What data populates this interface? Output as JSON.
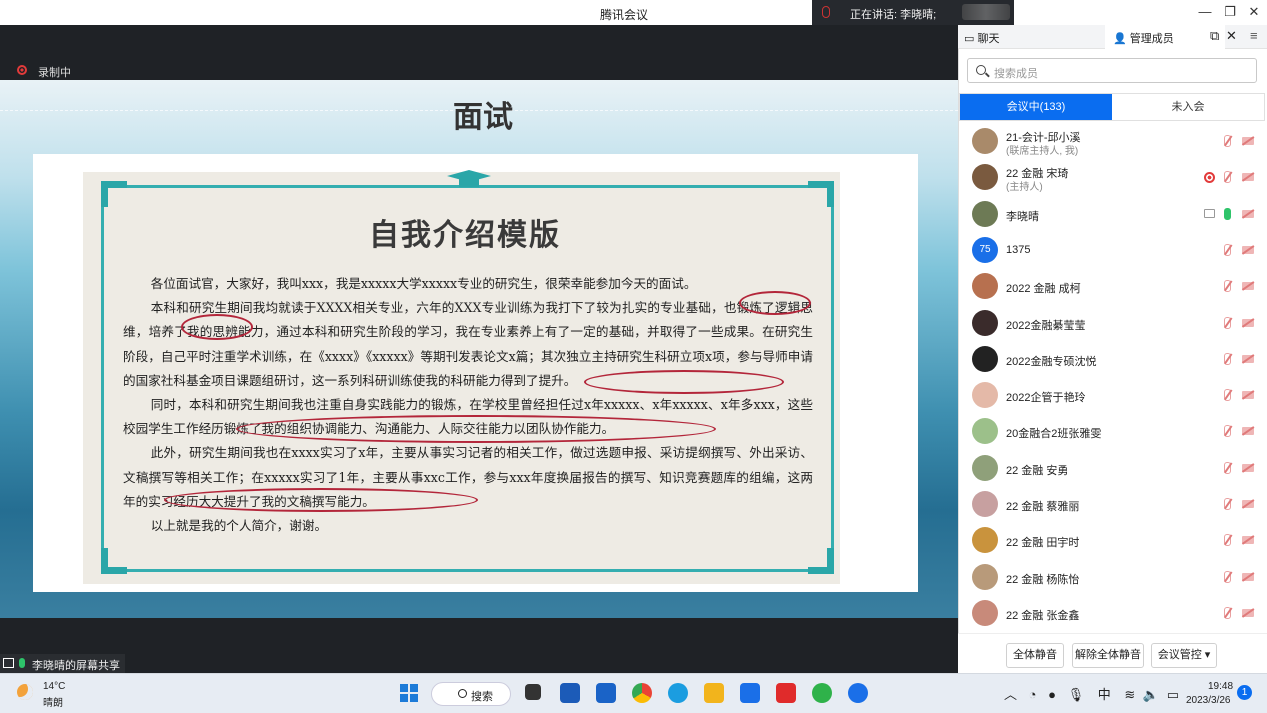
{
  "window": {
    "title": "腾讯会议",
    "speaking_label": "正在讲话: 李晓晴;",
    "min": "—",
    "restore": "❐",
    "close": "✕"
  },
  "meeting": {
    "recording_label": "录制中",
    "share_label": "李晓晴的屏幕共享"
  },
  "slide": {
    "title": "面试",
    "doc_title": "自我介绍模版",
    "paragraphs": [
      "各位面试官，大家好，我叫xxx，我是xxxxx大学xxxxx专业的研究生，很荣幸能参加今天的面试。",
      "本科和研究生期间我均就读于XXXX相关专业，六年的XXX专业训练为我打下了较为扎实的专业基础，也锻炼了逻辑思维，培养了我的思辨能力，通过本科和研究生阶段的学习，我在专业素养上有了一定的基础，并取得了一些成果。在研究生阶段，自己平时注重学术训练，在《xxxx》《xxxxx》等期刊发表论文x篇；其次独立主持研究生科研立项x项，参与导师申请的国家社科基金项目课题组研讨，这一系列科研训练使我的科研能力得到了提升。",
      "同时，本科和研究生期间我也注重自身实践能力的锻炼，在学校里曾经担任过x年xxxxx、x年xxxxx、x年多xxx，这些校园学生工作经历锻炼了我的组织协调能力、沟通能力、人际交往能力以团队协作能力。",
      "此外，研究生期间我也在xxxx实习了x年，主要从事实习记者的相关工作，做过选题申报、采访提纲撰写、外出采访、文稿撰写等相关工作；在xxxxx实习了1年，主要从事xxc工作，参与xxx年度换届报告的撰写、知识竞赛题库的组编，这两年的实习经历大大提升了我的文稿撰写能力。",
      "以上就是我的个人简介，谢谢。"
    ]
  },
  "panel": {
    "tab_chat": "聊天",
    "tab_members": "管理成员",
    "search_placeholder": "搜索成员",
    "seg_in": "会议中(133)",
    "seg_out": "未入会",
    "members": [
      {
        "name": "21-会计-邱小溪",
        "sub": "(联席主持人, 我)",
        "color": "#a98a6a"
      },
      {
        "name": "22 金融 宋琦",
        "sub": "(主持人)",
        "color": "#7a5a3f"
      },
      {
        "name": "李晓晴",
        "sub": "",
        "color": "#6d7a55"
      },
      {
        "name": "1375",
        "sub": "",
        "color": "#1a6fe8",
        "initials": "75"
      },
      {
        "name": "2022 金融 成柯",
        "sub": "",
        "color": "#b7704f"
      },
      {
        "name": "2022金融綦莹莹",
        "sub": "",
        "color": "#3a2b2b"
      },
      {
        "name": "2022金融专硕沈悦",
        "sub": "",
        "color": "#222222"
      },
      {
        "name": "2022企管于艳玲",
        "sub": "",
        "color": "#e4b9a8"
      },
      {
        "name": "20金融合2班张雅雯",
        "sub": "",
        "color": "#9cc08a"
      },
      {
        "name": "22 金融 安勇",
        "sub": "",
        "color": "#8fa07a"
      },
      {
        "name": "22 金融 蔡雅丽",
        "sub": "",
        "color": "#c7a0a0"
      },
      {
        "name": "22 金融 田宇时",
        "sub": "",
        "color": "#c9933d"
      },
      {
        "name": "22 金融 杨陈怡",
        "sub": "",
        "color": "#b89a7a"
      },
      {
        "name": "22 金融 张金鑫",
        "sub": "",
        "color": "#c88a7a"
      }
    ],
    "btn_mute_all": "全体静音",
    "btn_unmute_all": "解除全体静音",
    "btn_control": "会议管控 ▾"
  },
  "taskbar": {
    "temp": "14°C",
    "condition": "晴朗",
    "search": "搜索",
    "tray_ime": "中",
    "time": "19:48",
    "date": "2023/3/26",
    "notifications": "1"
  }
}
